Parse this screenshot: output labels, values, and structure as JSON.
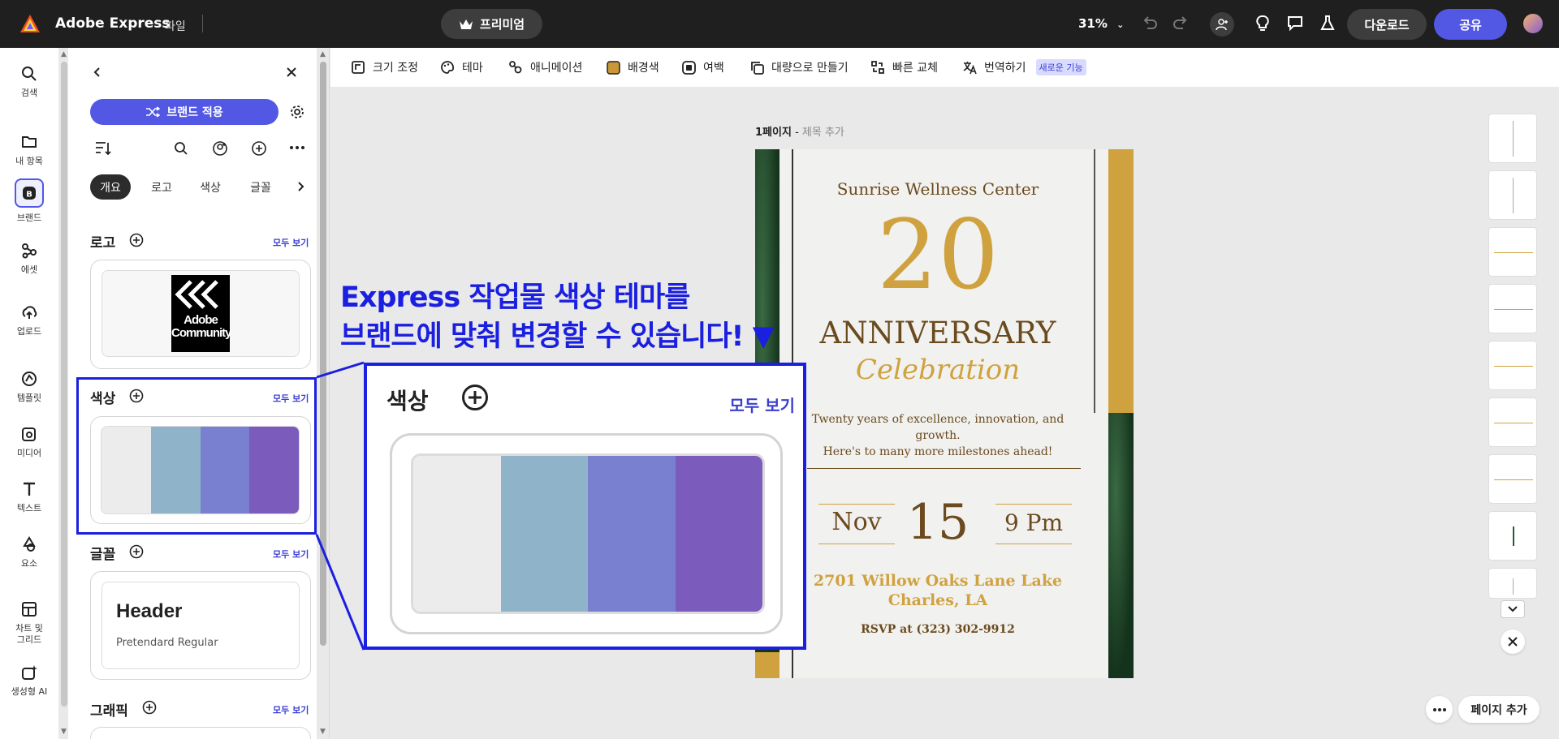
{
  "app": {
    "name": "Adobe Express",
    "file_menu": "파일"
  },
  "topbar": {
    "premium_label": "프리미엄",
    "zoom": "31%",
    "download_label": "다운로드",
    "share_label": "공유"
  },
  "rail": [
    {
      "label": "검색",
      "icon": "search-icon"
    },
    {
      "label": "내 항목",
      "icon": "folder-icon"
    },
    {
      "label": "브랜드",
      "icon": "brand-icon"
    },
    {
      "label": "에셋",
      "icon": "assets-icon"
    },
    {
      "label": "업로드",
      "icon": "upload-icon"
    },
    {
      "label": "템플릿",
      "icon": "templates-icon"
    },
    {
      "label": "미디어",
      "icon": "media-icon"
    },
    {
      "label": "텍스트",
      "icon": "text-icon"
    },
    {
      "label": "요소",
      "icon": "elements-icon"
    },
    {
      "label": "차트 및\n그리드",
      "icon": "chart-grid-icon"
    },
    {
      "label": "생성형 AI",
      "icon": "generative-ai-icon"
    }
  ],
  "panel": {
    "apply_brand_label": "브랜드 적용",
    "tabs": [
      "개요",
      "로고",
      "색상",
      "글꼴"
    ],
    "see_all": "모두 보기",
    "sections": {
      "logo": "로고",
      "color": "색상",
      "font": "글꼴",
      "graphic": "그래픽"
    },
    "logo_text_1": "Adobe",
    "logo_text_2": "Community",
    "font_header": "Header",
    "font_name": "Pretendard Regular",
    "palette": [
      "#ececec",
      "#8fb4c9",
      "#7880cf",
      "#7b5bbb"
    ]
  },
  "toolbar": [
    {
      "label": "크기 조정",
      "icon": "resize-icon"
    },
    {
      "label": "테마",
      "icon": "palette-icon"
    },
    {
      "label": "애니메이션",
      "icon": "animation-icon"
    },
    {
      "label": "배경색",
      "icon": "background-color-icon"
    },
    {
      "label": "여백",
      "icon": "margin-icon"
    },
    {
      "label": "대량으로 만들기",
      "icon": "bulk-create-icon"
    },
    {
      "label": "빠른 교체",
      "icon": "quick-swap-icon"
    },
    {
      "label": "번역하기",
      "icon": "translate-icon"
    }
  ],
  "new_feature_badge": "새로운 기능",
  "page": {
    "label": "1페이지",
    "separator": " - ",
    "title_placeholder": "제목 추가"
  },
  "invitation": {
    "venue": "Sunrise Wellness Center",
    "number": "20",
    "headline": "ANNIVERSARY",
    "subhead": "Celebration",
    "body_1": "Twenty years of excellence, innovation, and growth.",
    "body_2": "Here's to many more milestones ahead!",
    "month": "Nov",
    "day": "15",
    "time": "9 Pm",
    "address_1": "2701 Willow Oaks Lane Lake",
    "address_2": "Charles, LA",
    "rsvp": "RSVP at (323) 302-9912"
  },
  "callout": {
    "line1": "Express 작업물 색상 테마를",
    "line2": "브랜드에 맞춰 변경할 수 있습니다! ▼"
  },
  "add_page_label": "페이지 추가",
  "colors": {
    "accent": "#5258e4",
    "callout": "#1a1fe0",
    "gold": "#d0a23f",
    "brown": "#6b4a1e"
  }
}
